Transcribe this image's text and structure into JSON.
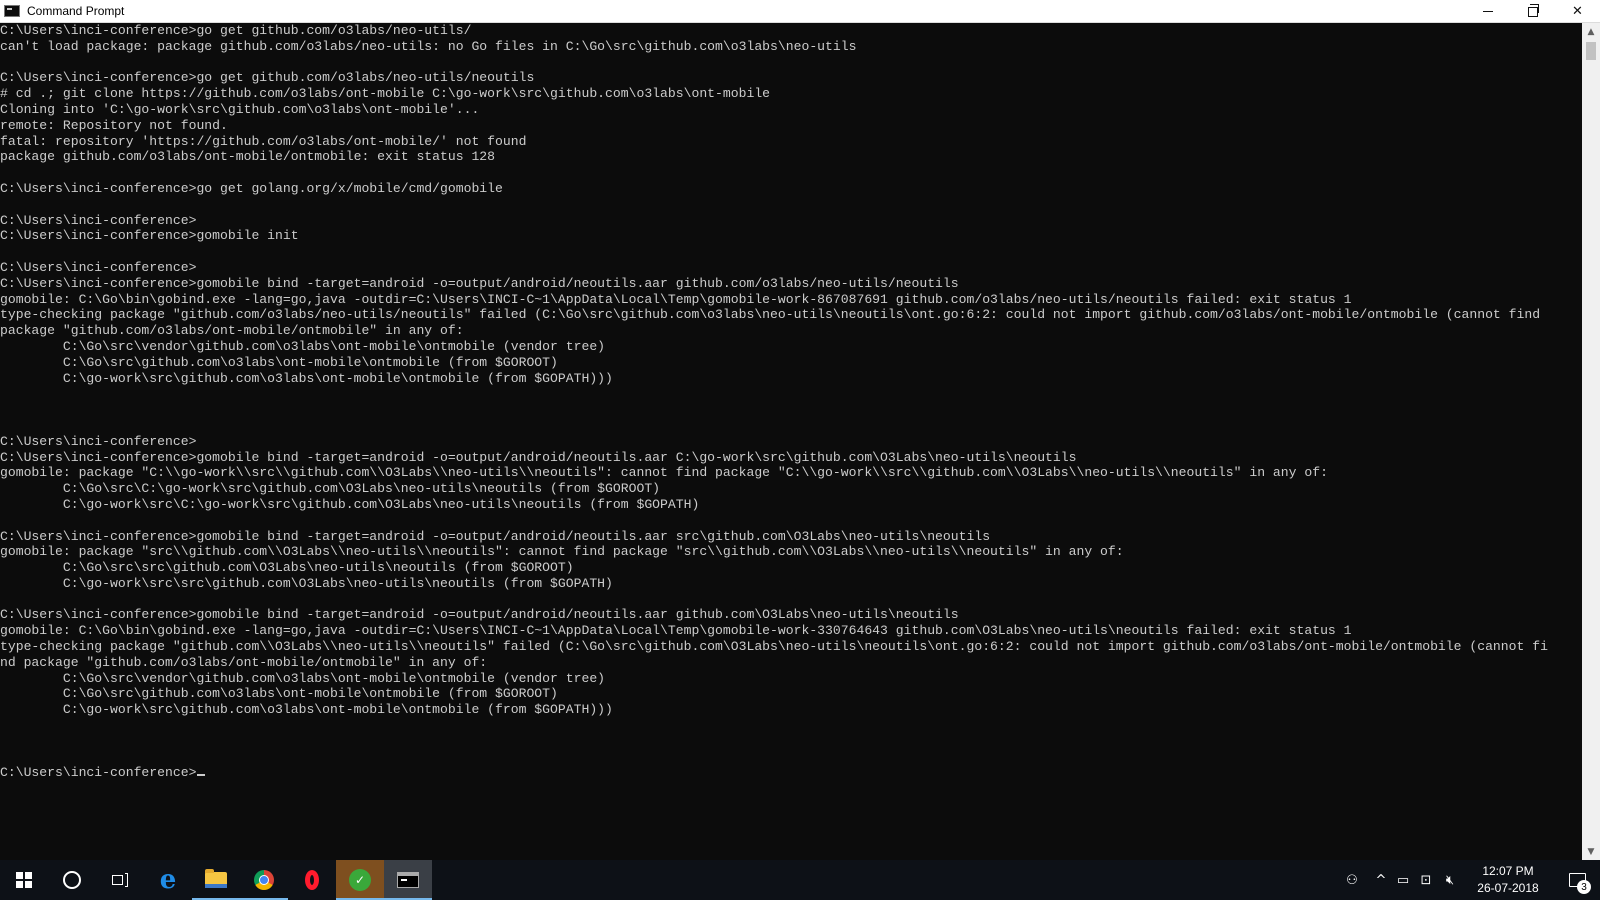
{
  "window": {
    "title": "Command Prompt",
    "minimize_glyph": "—",
    "maximize_glyph": "❐",
    "close_glyph": "✕"
  },
  "console": {
    "lines": [
      "C:\\Users\\inci-conference>go get github.com/o3labs/neo-utils/",
      "can't load package: package github.com/o3labs/neo-utils: no Go files in C:\\Go\\src\\github.com\\o3labs\\neo-utils",
      "",
      "C:\\Users\\inci-conference>go get github.com/o3labs/neo-utils/neoutils",
      "# cd .; git clone https://github.com/o3labs/ont-mobile C:\\go-work\\src\\github.com\\o3labs\\ont-mobile",
      "Cloning into 'C:\\go-work\\src\\github.com\\o3labs\\ont-mobile'...",
      "remote: Repository not found.",
      "fatal: repository 'https://github.com/o3labs/ont-mobile/' not found",
      "package github.com/o3labs/ont-mobile/ontmobile: exit status 128",
      "",
      "C:\\Users\\inci-conference>go get golang.org/x/mobile/cmd/gomobile",
      "",
      "C:\\Users\\inci-conference>",
      "C:\\Users\\inci-conference>gomobile init",
      "",
      "C:\\Users\\inci-conference>",
      "C:\\Users\\inci-conference>gomobile bind -target=android -o=output/android/neoutils.aar github.com/o3labs/neo-utils/neoutils",
      "gomobile: C:\\Go\\bin\\gobind.exe -lang=go,java -outdir=C:\\Users\\INCI-C~1\\AppData\\Local\\Temp\\gomobile-work-867087691 github.com/o3labs/neo-utils/neoutils failed: exit status 1",
      "type-checking package \"github.com/o3labs/neo-utils/neoutils\" failed (C:\\Go\\src\\github.com\\o3labs\\neo-utils\\neoutils\\ont.go:6:2: could not import github.com/o3labs/ont-mobile/ontmobile (cannot find",
      "package \"github.com/o3labs/ont-mobile/ontmobile\" in any of:",
      "        C:\\Go\\src\\vendor\\github.com\\o3labs\\ont-mobile\\ontmobile (vendor tree)",
      "        C:\\Go\\src\\github.com\\o3labs\\ont-mobile\\ontmobile (from $GOROOT)",
      "        C:\\go-work\\src\\github.com\\o3labs\\ont-mobile\\ontmobile (from $GOPATH)))",
      "",
      "",
      "",
      "C:\\Users\\inci-conference>",
      "C:\\Users\\inci-conference>gomobile bind -target=android -o=output/android/neoutils.aar C:\\go-work\\src\\github.com\\O3Labs\\neo-utils\\neoutils",
      "gomobile: package \"C:\\\\go-work\\\\src\\\\github.com\\\\O3Labs\\\\neo-utils\\\\neoutils\": cannot find package \"C:\\\\go-work\\\\src\\\\github.com\\\\O3Labs\\\\neo-utils\\\\neoutils\" in any of:",
      "        C:\\Go\\src\\C:\\go-work\\src\\github.com\\O3Labs\\neo-utils\\neoutils (from $GOROOT)",
      "        C:\\go-work\\src\\C:\\go-work\\src\\github.com\\O3Labs\\neo-utils\\neoutils (from $GOPATH)",
      "",
      "C:\\Users\\inci-conference>gomobile bind -target=android -o=output/android/neoutils.aar src\\github.com\\O3Labs\\neo-utils\\neoutils",
      "gomobile: package \"src\\\\github.com\\\\O3Labs\\\\neo-utils\\\\neoutils\": cannot find package \"src\\\\github.com\\\\O3Labs\\\\neo-utils\\\\neoutils\" in any of:",
      "        C:\\Go\\src\\src\\github.com\\O3Labs\\neo-utils\\neoutils (from $GOROOT)",
      "        C:\\go-work\\src\\src\\github.com\\O3Labs\\neo-utils\\neoutils (from $GOPATH)",
      "",
      "C:\\Users\\inci-conference>gomobile bind -target=android -o=output/android/neoutils.aar github.com\\O3Labs\\neo-utils\\neoutils",
      "gomobile: C:\\Go\\bin\\gobind.exe -lang=go,java -outdir=C:\\Users\\INCI-C~1\\AppData\\Local\\Temp\\gomobile-work-330764643 github.com\\O3Labs\\neo-utils\\neoutils failed: exit status 1",
      "type-checking package \"github.com\\\\O3Labs\\\\neo-utils\\\\neoutils\" failed (C:\\Go\\src\\github.com\\O3Labs\\neo-utils\\neoutils\\ont.go:6:2: could not import github.com/o3labs/ont-mobile/ontmobile (cannot fi",
      "nd package \"github.com/o3labs/ont-mobile/ontmobile\" in any of:",
      "        C:\\Go\\src\\vendor\\github.com\\o3labs\\ont-mobile\\ontmobile (vendor tree)",
      "        C:\\Go\\src\\github.com\\o3labs\\ont-mobile\\ontmobile (from $GOROOT)",
      "        C:\\go-work\\src\\github.com\\o3labs\\ont-mobile\\ontmobile (from $GOPATH)))",
      "",
      "",
      "",
      "C:\\Users\\inci-conference>"
    ],
    "text_color": "#cccccc",
    "background_color": "#0c0c0c"
  },
  "scrollbar": {
    "up_glyph": "▲",
    "down_glyph": "▼"
  },
  "taskbar": {
    "apps": [
      {
        "name": "start",
        "icon": "windows-logo-icon"
      },
      {
        "name": "cortana",
        "icon": "cortana-circle-icon"
      },
      {
        "name": "task-view",
        "icon": "task-view-icon"
      },
      {
        "name": "edge",
        "icon": "edge-icon",
        "glyph": "e"
      },
      {
        "name": "file-explorer",
        "icon": "folder-icon"
      },
      {
        "name": "chrome",
        "icon": "chrome-icon"
      },
      {
        "name": "opera",
        "icon": "opera-icon"
      },
      {
        "name": "green-app",
        "icon": "green-app-icon",
        "glyph": "✓"
      },
      {
        "name": "command-prompt",
        "icon": "cmd-icon"
      }
    ],
    "tray": {
      "people_glyph": "⚇",
      "chevron_glyph": "^",
      "battery_glyph": "▭",
      "network_glyph": "⊡",
      "volume_glyph": "🔇︎"
    },
    "clock": {
      "time": "12:07 PM",
      "date": "26-07-2018"
    },
    "notifications": {
      "count": "3"
    },
    "accent_color": "#76b9ed"
  }
}
